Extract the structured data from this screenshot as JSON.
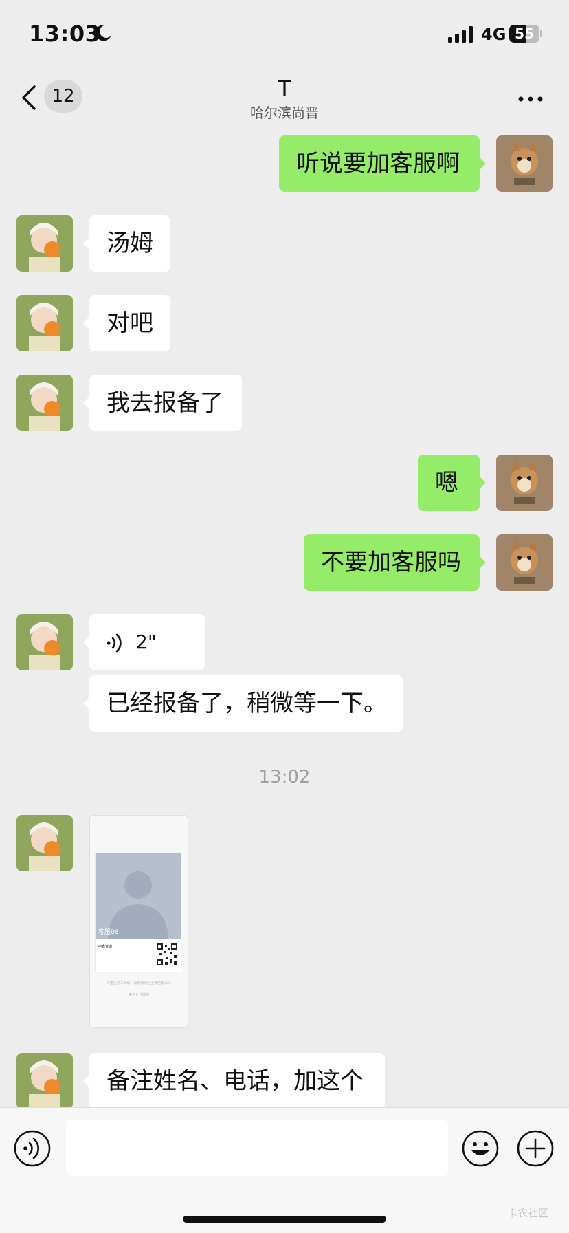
{
  "status_bar": {
    "time": "13:03",
    "network": "4G",
    "battery": "55",
    "battery_level": 0.55
  },
  "nav": {
    "back_count": "12",
    "title": "T",
    "subtitle": "哈尔滨尚晋"
  },
  "messages": [
    {
      "side": "right",
      "text": "听说要加客服啊"
    },
    {
      "side": "left",
      "text": "汤姆"
    },
    {
      "side": "left",
      "text": "对吧"
    },
    {
      "side": "left",
      "text": "我去报备了"
    },
    {
      "side": "right",
      "text": "嗯"
    },
    {
      "side": "right",
      "text": "不要加客服吗"
    },
    {
      "side": "left",
      "type": "voice",
      "text": "2\""
    },
    {
      "side": "left",
      "text": "已经报备了，稍微等一下。"
    },
    {
      "side": "left",
      "type": "image"
    },
    {
      "side": "left",
      "text": "备注姓名、电话，加这个"
    }
  ],
  "timestamp": "13:02",
  "qr_card": {
    "label": "客服08",
    "org": "中鑫资询",
    "hint1": "扫描上方二维码，添加我为企业微信联系人",
    "hint2": "来自企业微信"
  },
  "input": {
    "placeholder": ""
  },
  "icons": [
    "moon-icon",
    "signal-icon",
    "back-icon",
    "more-icon",
    "voice-icon",
    "emoji-icon",
    "plus-icon"
  ],
  "colors": {
    "outgoing_bubble": "#95ec69",
    "incoming_bubble": "#ffffff",
    "background": "#ededed"
  },
  "watermark": "卡农社区"
}
